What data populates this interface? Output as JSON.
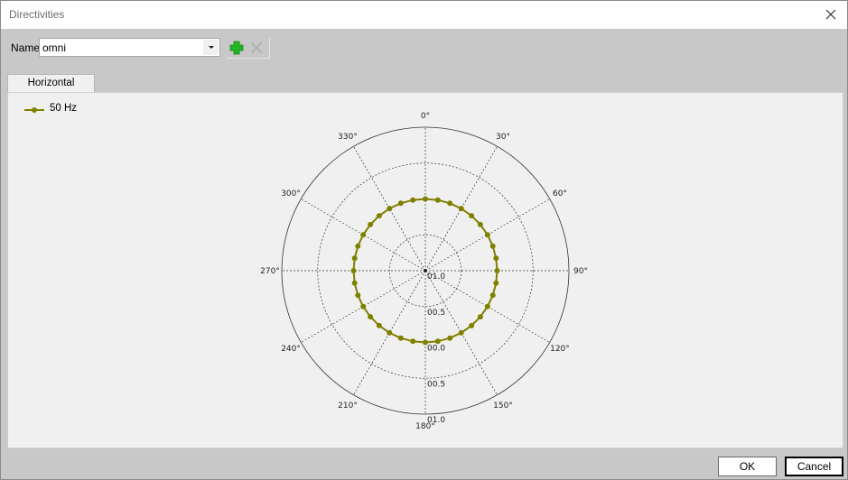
{
  "window": {
    "title": "Directivities"
  },
  "toolbar": {
    "name_label": "Name",
    "name_value": "omni",
    "add_icon": "plus-icon",
    "delete_icon": "x-icon"
  },
  "tabs": [
    {
      "label": "Horizontal",
      "selected": true
    }
  ],
  "footer": {
    "ok_label": "OK",
    "cancel_label": "Cancel"
  },
  "chart_data": {
    "type": "polar-line",
    "angular_labels": [
      "0°",
      "30°",
      "60°",
      "90°",
      "120°",
      "150°",
      "180°",
      "210°",
      "240°",
      "270°",
      "300°",
      "330°"
    ],
    "radial_tick_labels": [
      "01.0",
      "00.5",
      "00.0",
      "00.5",
      "01.0"
    ],
    "series": [
      {
        "name": "50 Hz",
        "color": "#808000",
        "marker": "circle",
        "angles_deg": [
          0,
          10,
          20,
          30,
          40,
          50,
          60,
          70,
          80,
          90,
          100,
          110,
          120,
          130,
          140,
          150,
          160,
          170,
          180,
          190,
          200,
          210,
          220,
          230,
          240,
          250,
          260,
          270,
          280,
          290,
          300,
          310,
          320,
          330,
          340,
          350
        ],
        "radius_fraction": 0.5
      }
    ],
    "legend": "top-left",
    "grid": true
  }
}
